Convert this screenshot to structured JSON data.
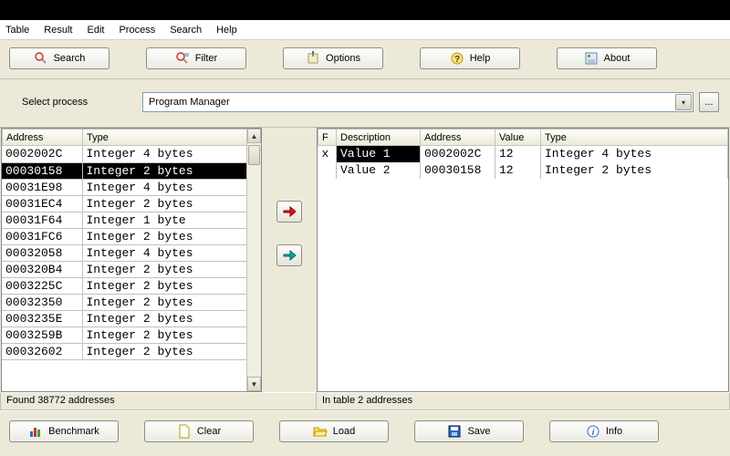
{
  "menu": [
    "Table",
    "Result",
    "Edit",
    "Process",
    "Search",
    "Help"
  ],
  "toolbar": {
    "search": "Search",
    "filter": "Filter",
    "options": "Options",
    "help": "Help",
    "about": "About"
  },
  "process": {
    "label": "Select process",
    "value": "Program Manager",
    "browse": "..."
  },
  "left_table": {
    "headers": {
      "address": "Address",
      "type": "Type"
    },
    "rows": [
      {
        "address": "0002002C",
        "type": "Integer 4 bytes",
        "selected": false
      },
      {
        "address": "00030158",
        "type": "Integer 2 bytes",
        "selected": true
      },
      {
        "address": "00031E98",
        "type": "Integer 4 bytes",
        "selected": false
      },
      {
        "address": "00031EC4",
        "type": "Integer 2 bytes",
        "selected": false
      },
      {
        "address": "00031F64",
        "type": "Integer 1 byte",
        "selected": false
      },
      {
        "address": "00031FC6",
        "type": "Integer 2 bytes",
        "selected": false
      },
      {
        "address": "00032058",
        "type": "Integer 4 bytes",
        "selected": false
      },
      {
        "address": "000320B4",
        "type": "Integer 2 bytes",
        "selected": false
      },
      {
        "address": "0003225C",
        "type": "Integer 2 bytes",
        "selected": false
      },
      {
        "address": "00032350",
        "type": "Integer 2 bytes",
        "selected": false
      },
      {
        "address": "0003235E",
        "type": "Integer 2 bytes",
        "selected": false
      },
      {
        "address": "0003259B",
        "type": "Integer 2 bytes",
        "selected": false
      },
      {
        "address": "00032602",
        "type": "Integer 2 bytes",
        "selected": false
      }
    ]
  },
  "right_table": {
    "headers": {
      "f": "F",
      "desc": "Description",
      "address": "Address",
      "value": "Value",
      "type": "Type"
    },
    "rows": [
      {
        "f": "x",
        "desc": "Value 1",
        "address": "0002002C",
        "value": "12",
        "type": "Integer 4 bytes",
        "selected": true
      },
      {
        "f": "",
        "desc": "Value 2",
        "address": "00030158",
        "value": "12",
        "type": "Integer 2 bytes",
        "selected": false
      }
    ]
  },
  "status": {
    "left": "Found 38772 addresses",
    "right": "In table 2 addresses"
  },
  "bottom": {
    "benchmark": "Benchmark",
    "clear": "Clear",
    "load": "Load",
    "save": "Save",
    "info": "Info"
  }
}
